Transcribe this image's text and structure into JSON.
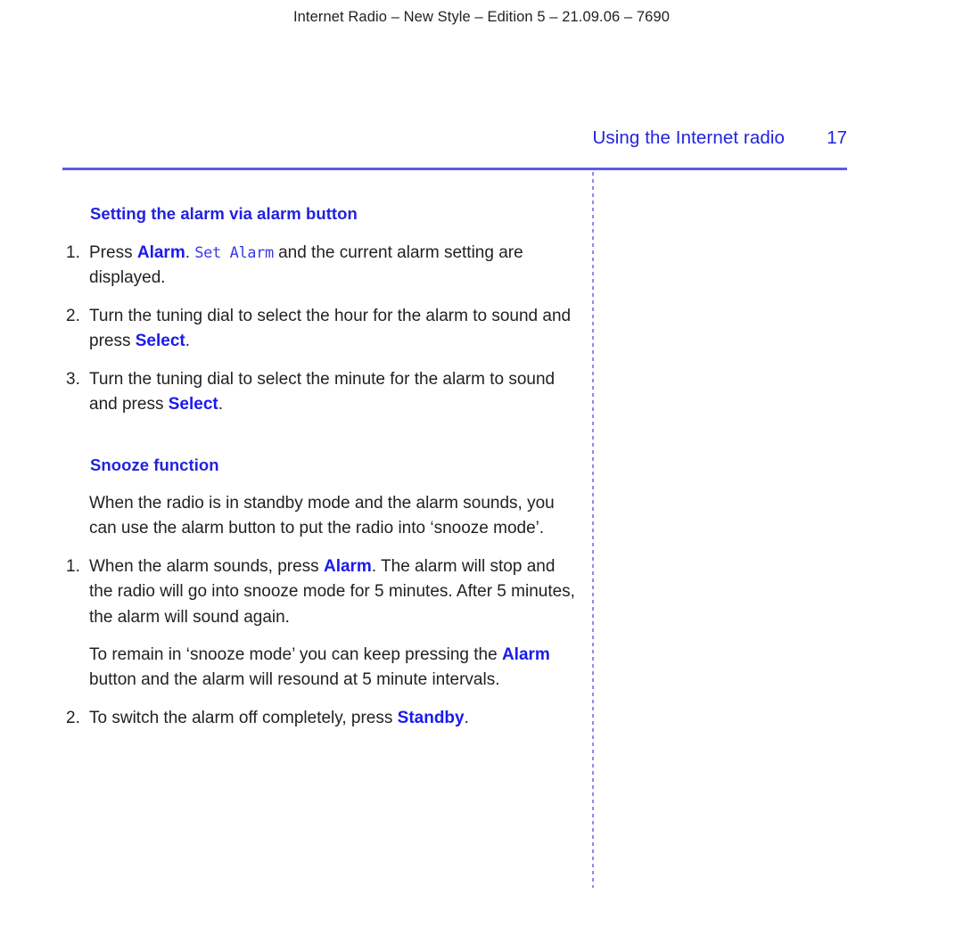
{
  "document": {
    "running_header": "Internet Radio – New Style – Edition 5 – 21.09.06 – 7690",
    "chapter_title": "Using the Internet radio",
    "page_number": "17",
    "accent_blue": "#2222dd",
    "button_blue": "#1a1aee",
    "rule_blue": "#5a5af0",
    "divider_blue": "#8b8bf0",
    "body_color": "#231f20"
  },
  "sections": {
    "alarm": {
      "heading": "Setting the alarm via alarm button",
      "items": [
        {
          "number": "1.",
          "pre": "Press ",
          "button": "Alarm",
          "mid": ". ",
          "lcd": "Set Alarm",
          "post": " and the current alarm setting are displayed."
        },
        {
          "number": "2.",
          "pre": "Turn the tuning dial to select the hour for the alarm to sound and press ",
          "button": "Select",
          "post": "."
        },
        {
          "number": "3.",
          "pre": "Turn the tuning dial to select the minute for the alarm to sound and press ",
          "button": "Select",
          "post": "."
        }
      ]
    },
    "snooze": {
      "heading": "Snooze function",
      "intro": "When the radio is in standby mode and the alarm sounds, you can use the alarm button to put the radio into ‘snooze mode’.",
      "items": [
        {
          "number": "1.",
          "pre": "When the alarm sounds, press ",
          "button": "Alarm",
          "post": ". The alarm will stop and the radio will go into snooze mode for 5 minutes. After 5 minutes, the alarm will sound again."
        },
        {
          "number": "2.",
          "pre": "To switch the alarm off completely, press ",
          "button": "Standby",
          "post": "."
        }
      ],
      "keep_pressing": {
        "pre": "To remain in ‘snooze mode’ you can keep pressing the ",
        "button": "Alarm",
        "post": " button and the alarm will resound at 5 minute intervals."
      }
    }
  }
}
